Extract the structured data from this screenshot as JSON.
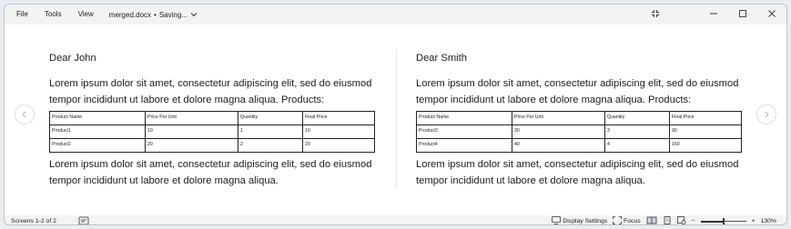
{
  "titlebar": {
    "menu": [
      "File",
      "Tools",
      "View"
    ],
    "document_title": "merged.docx",
    "separator": "•",
    "status": "Saving...",
    "icons": [
      "expand-icon",
      "minimize-icon",
      "maximize-icon",
      "close-icon"
    ]
  },
  "pages": [
    {
      "salutation": "Dear John",
      "intro": "Lorem ipsum dolor sit amet, consectetur adipiscing elit, sed do eiusmod tempor incididunt ut labore et dolore magna aliqua. Products:",
      "table": {
        "headers": [
          "Product Name",
          "Price Per Unit",
          "Quantity",
          "Final Price"
        ],
        "rows": [
          [
            "Product1",
            "10",
            "1",
            "10"
          ],
          [
            "Product2",
            "20",
            "2",
            "20"
          ]
        ]
      },
      "closing": "Lorem ipsum dolor sit amet, consectetur adipiscing elit, sed do eiusmod tempor incididunt ut labore et dolore magna aliqua."
    },
    {
      "salutation": "Dear Smith",
      "intro": "Lorem ipsum dolor sit amet, consectetur adipiscing elit, sed do eiusmod tempor incididunt ut labore et dolore magna aliqua. Products:",
      "table": {
        "headers": [
          "Product Name",
          "Price Per Unit",
          "Quantity",
          "Final Price"
        ],
        "rows": [
          [
            "Product3",
            "30",
            "3",
            "90"
          ],
          [
            "Product4",
            "40",
            "4",
            "160"
          ]
        ]
      },
      "closing": "Lorem ipsum dolor sit amet, consectetur adipiscing elit, sed do eiusmod tempor incididunt ut labore et dolore magna aliqua."
    }
  ],
  "statusbar": {
    "screens": "Screens 1-2 of 2",
    "display_settings": "Display Settings",
    "focus": "Focus",
    "zoom_minus": "−",
    "zoom_plus": "+",
    "zoom_level": "130%",
    "zoom_fraction": 0.5
  },
  "colors": {
    "titlebar_bg": "#f3f3f3",
    "page_bg": "#ffffff",
    "window_border": "#b8c4d4"
  }
}
